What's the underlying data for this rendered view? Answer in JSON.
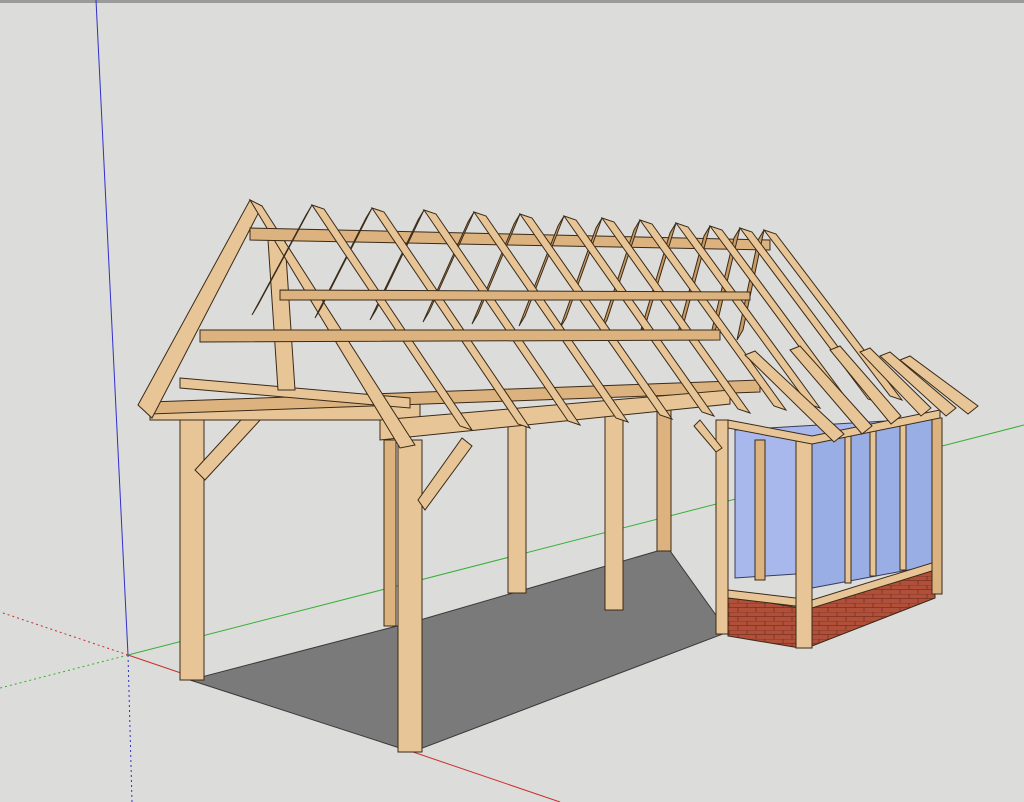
{
  "scene": {
    "background": "#dcdcda",
    "floor_color": "#7a7a7a",
    "timber_color": "#e8c596",
    "glass_color": "#a8b8ec",
    "brick_color": "#b0503a",
    "axis_colors": {
      "blue": "#3030c8",
      "green": "#38b038",
      "red": "#c83030"
    }
  }
}
